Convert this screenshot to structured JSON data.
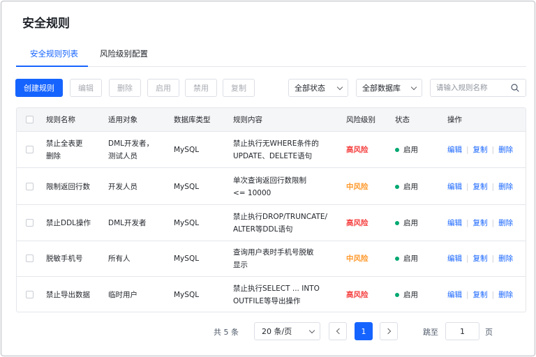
{
  "page_title": "安全规则",
  "tabs": [
    {
      "label": "安全规则列表",
      "active": true
    },
    {
      "label": "风险级别配置",
      "active": false
    }
  ],
  "toolbar": {
    "create": "创建规则",
    "edit": "编辑",
    "delete": "删除",
    "enable": "启用",
    "disable": "禁用",
    "copy": "复制",
    "status_filter": "全部状态",
    "db_filter": "全部数据库",
    "search_placeholder": "请输入规则名称"
  },
  "table": {
    "headers": {
      "name": "规则名称",
      "target": "适用对象",
      "db_type": "数据库类型",
      "content": "规则内容",
      "risk": "风险级别",
      "status": "状态",
      "actions": "操作"
    },
    "rows": [
      {
        "name_1": "禁止全表更",
        "name_2": "删除",
        "target_1": "DML开发者，",
        "target_2": "测试人员",
        "db_type": "MySQL",
        "content_1": "禁止执行无WHERE条件的",
        "content_2": "UPDATE、DELETE语句",
        "risk": "高风险",
        "risk_level": "high",
        "status": "启用"
      },
      {
        "name_1": "限制返回行数",
        "name_2": "",
        "target_1": "开发人员",
        "target_2": "",
        "db_type": "MySQL",
        "content_1": "单次查询返回行数限制",
        "content_2": "<= 10000",
        "risk": "中风险",
        "risk_level": "medium",
        "status": "启用"
      },
      {
        "name_1": "禁止DDL操作",
        "name_2": "",
        "target_1": "DML开发者",
        "target_2": "",
        "db_type": "MySQL",
        "content_1": "禁止执行DROP/TRUNCATE/",
        "content_2": "ALTER等DDL语句",
        "risk": "高风险",
        "risk_level": "high",
        "status": "启用"
      },
      {
        "name_1": "脱敏手机号",
        "name_2": "",
        "target_1": "所有人",
        "target_2": "",
        "db_type": "MySQL",
        "content_1": "查询用户表时手机号脱敏",
        "content_2": "显示",
        "risk": "中风险",
        "risk_level": "medium",
        "status": "启用"
      },
      {
        "name_1": "禁止导出数据",
        "name_2": "",
        "target_1": "临时用户",
        "target_2": "",
        "db_type": "MySQL",
        "content_1": "禁止执行SELECT ... INTO",
        "content_2": "OUTFILE等导出操作",
        "risk": "高风险",
        "risk_level": "high",
        "status": "启用"
      }
    ],
    "actions": {
      "edit": "编辑",
      "copy": "复制",
      "delete": "删除",
      "sep": "|"
    }
  },
  "pagination": {
    "total": "共 5 条",
    "page_size": "20 条/页",
    "current_page": "1",
    "jump_label": "跳至",
    "jump_value": "1",
    "page_unit": "页"
  },
  "colors": {
    "primary": "#1664ff",
    "risk_high": "#f53f3f",
    "risk_medium": "#ff9a2e",
    "status_enabled": "#00a870"
  }
}
